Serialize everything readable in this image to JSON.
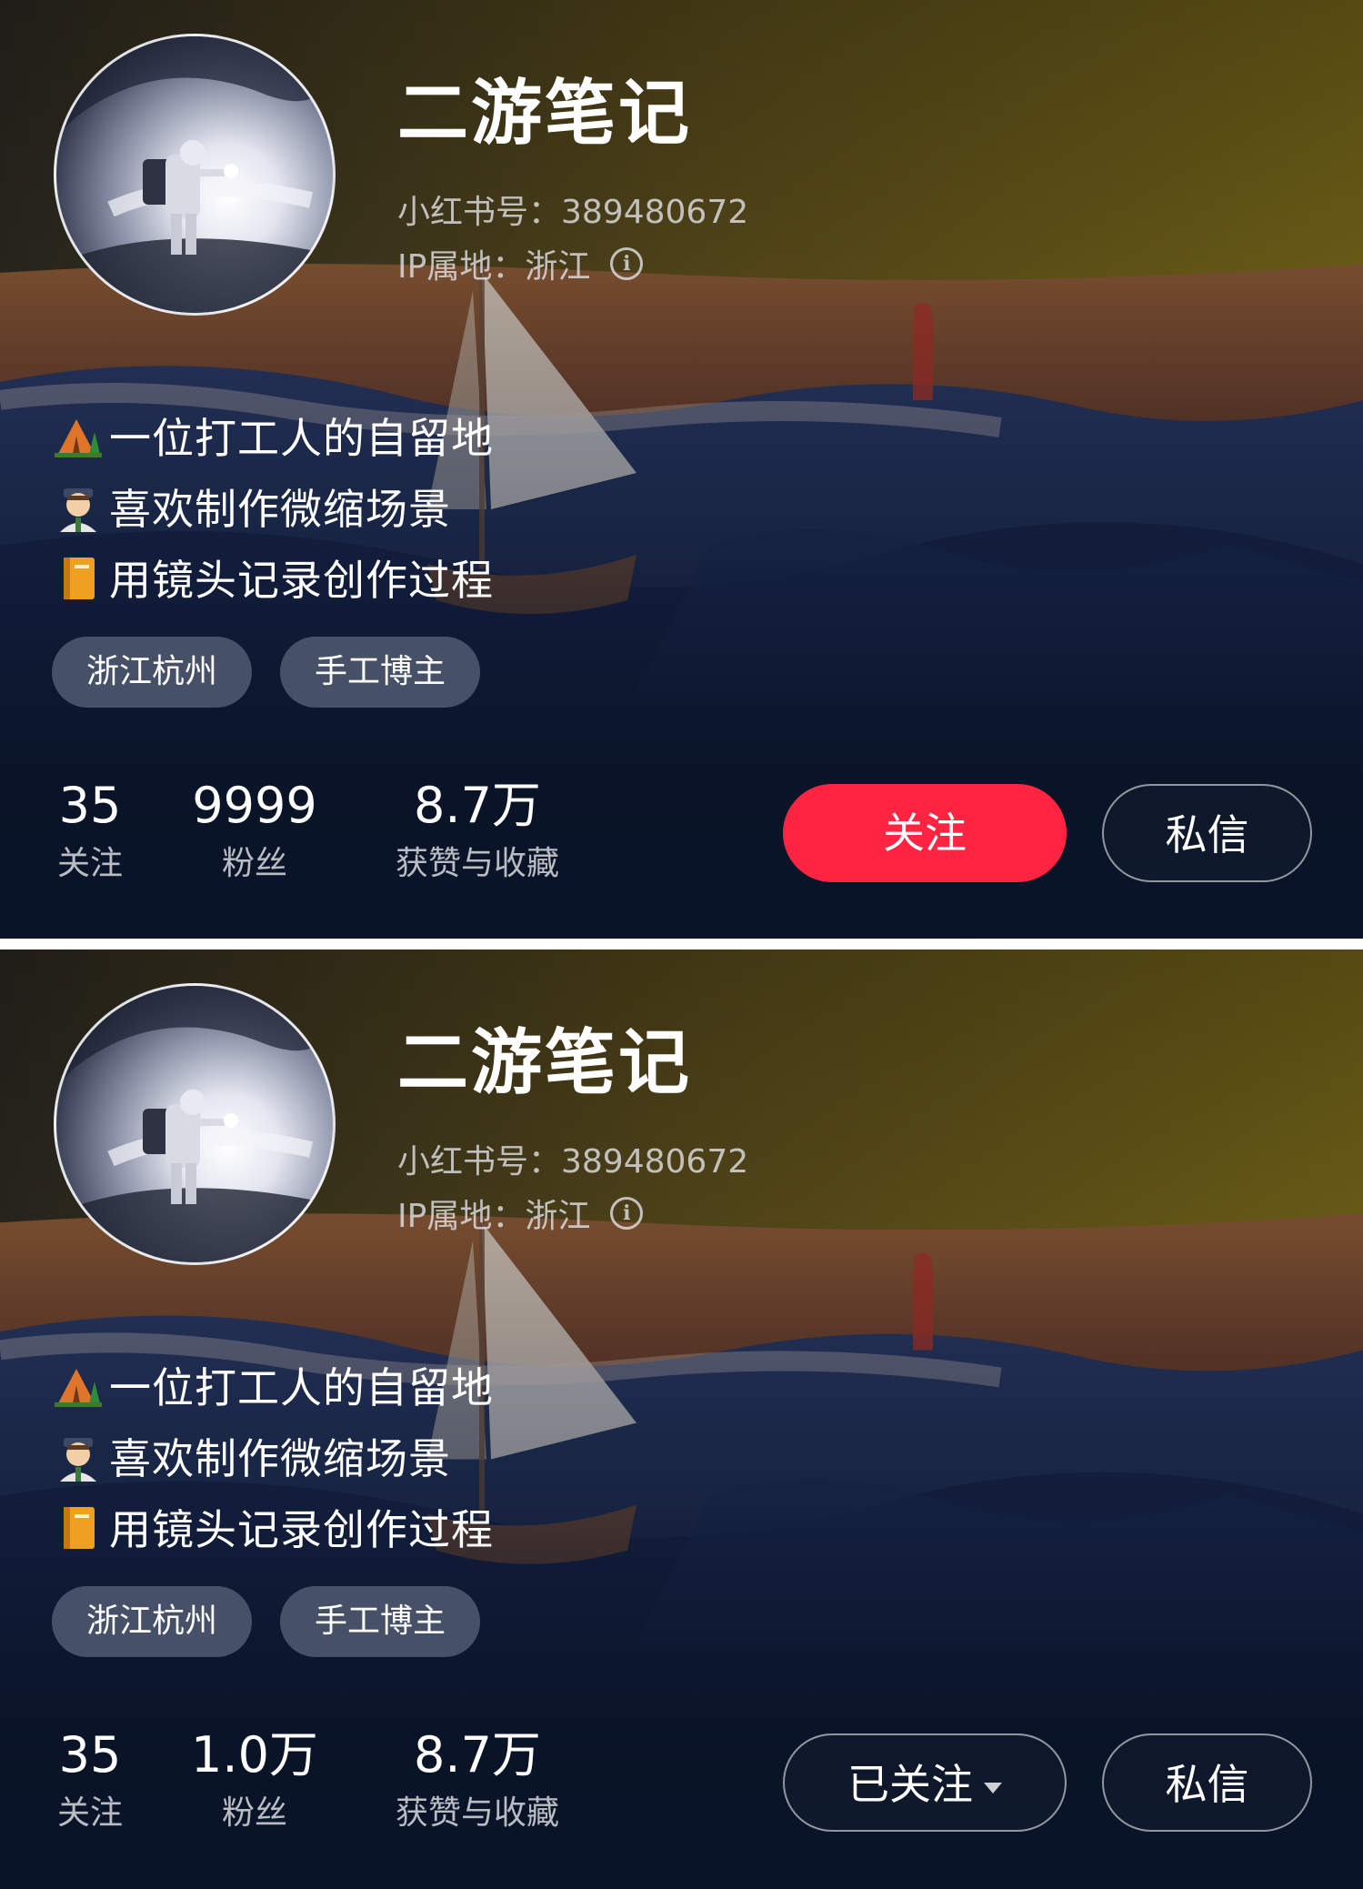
{
  "panels": [
    {
      "profile": {
        "nickname": "二游笔记",
        "red_id": "小红书号：389480672",
        "ip_location": "IP属地：浙江",
        "bio": [
          {
            "icon": "tent-icon",
            "text": "一位打工人的自留地"
          },
          {
            "icon": "man-icon",
            "text": "喜欢制作微缩场景"
          },
          {
            "icon": "book-icon",
            "text": "用镜头记录创作过程"
          }
        ],
        "tags": [
          "浙江杭州",
          "手工博主"
        ]
      },
      "stats": {
        "following": {
          "value": "35",
          "label": "关注"
        },
        "fans": {
          "value": "9999",
          "label": "粉丝"
        },
        "likes": {
          "value": "8.7万",
          "label": "获赞与收藏"
        }
      },
      "buttons": {
        "follow": "关注",
        "message": "私信"
      }
    },
    {
      "profile": {
        "nickname": "二游笔记",
        "red_id": "小红书号：389480672",
        "ip_location": "IP属地：浙江",
        "bio": [
          {
            "icon": "tent-icon",
            "text": "一位打工人的自留地"
          },
          {
            "icon": "man-icon",
            "text": "喜欢制作微缩场景"
          },
          {
            "icon": "book-icon",
            "text": "用镜头记录创作过程"
          }
        ],
        "tags": [
          "浙江杭州",
          "手工博主"
        ]
      },
      "stats": {
        "following": {
          "value": "35",
          "label": "关注"
        },
        "fans": {
          "value": "1.0万",
          "label": "粉丝"
        },
        "likes": {
          "value": "8.7万",
          "label": "获赞与收藏"
        }
      },
      "buttons": {
        "follow": "已关注",
        "message": "私信"
      }
    }
  ],
  "colors": {
    "follow_button": "#ff2442",
    "background": "#0d1830"
  }
}
